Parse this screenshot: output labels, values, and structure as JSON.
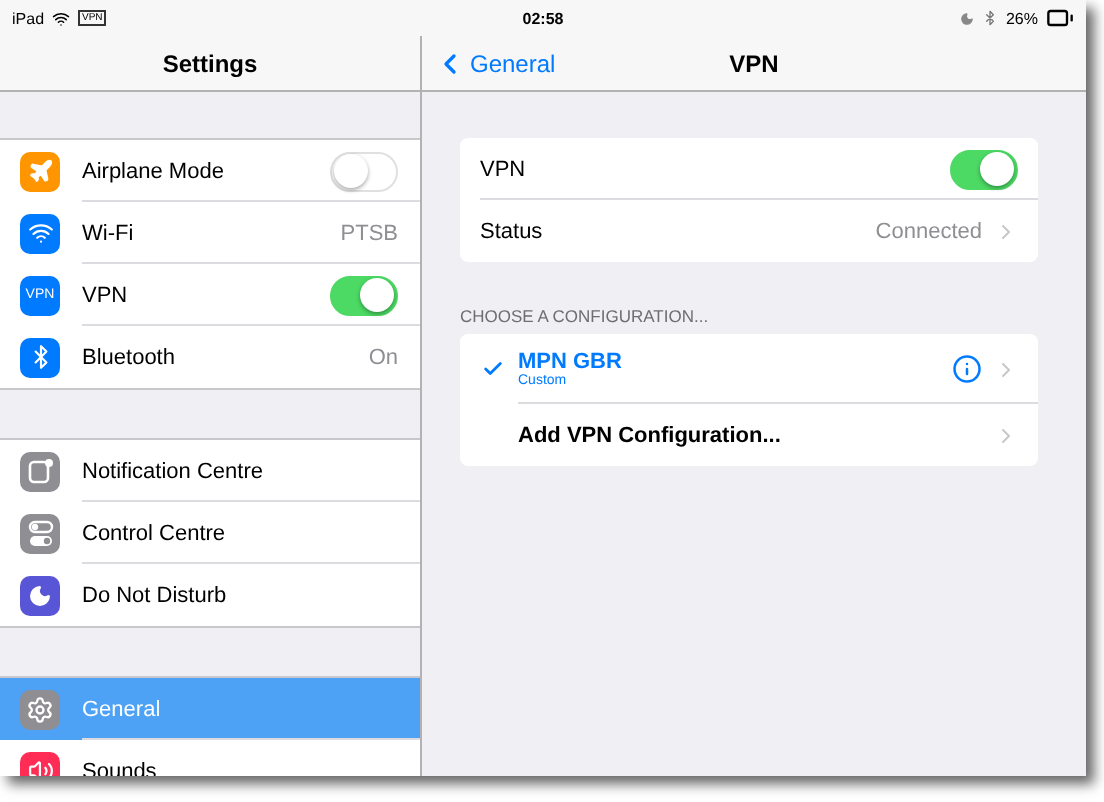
{
  "status_bar": {
    "device": "iPad",
    "vpn_badge": "VPN",
    "time": "02:58",
    "battery": "26%"
  },
  "sidebar": {
    "title": "Settings",
    "groups": [
      [
        {
          "label": "Airplane Mode",
          "color": "#ff9500",
          "kind": "toggle",
          "on": false,
          "selected": false
        },
        {
          "label": "Wi-Fi",
          "color": "#007aff",
          "kind": "value",
          "value": "PTSB",
          "selected": false
        },
        {
          "label": "VPN",
          "icon_text": "VPN",
          "color": "#007aff",
          "kind": "toggle",
          "on": true,
          "selected": false
        },
        {
          "label": "Bluetooth",
          "color": "#007aff",
          "kind": "value",
          "value": "On",
          "selected": false
        }
      ],
      [
        {
          "label": "Notification Centre",
          "color": "#8e8e93",
          "kind": "plain",
          "selected": false
        },
        {
          "label": "Control Centre",
          "color": "#8e8e93",
          "kind": "plain",
          "selected": false
        },
        {
          "label": "Do Not Disturb",
          "color": "#5856d6",
          "kind": "plain",
          "selected": false
        }
      ],
      [
        {
          "label": "General",
          "color": "#8e8e93",
          "kind": "plain",
          "selected": true
        },
        {
          "label": "Sounds",
          "color": "#ff2d55",
          "kind": "plain",
          "selected": false
        }
      ]
    ]
  },
  "detail": {
    "back": "General",
    "title": "VPN",
    "rows": [
      {
        "label": "VPN",
        "kind": "toggle",
        "on": true
      },
      {
        "label": "Status",
        "kind": "link",
        "value": "Connected"
      }
    ],
    "section_header": "CHOOSE A CONFIGURATION...",
    "configurations": [
      {
        "kind": "config",
        "name": "MPN GBR",
        "subtitle": "Custom",
        "selected": true
      },
      {
        "kind": "add",
        "name": "Add VPN Configuration..."
      }
    ]
  }
}
